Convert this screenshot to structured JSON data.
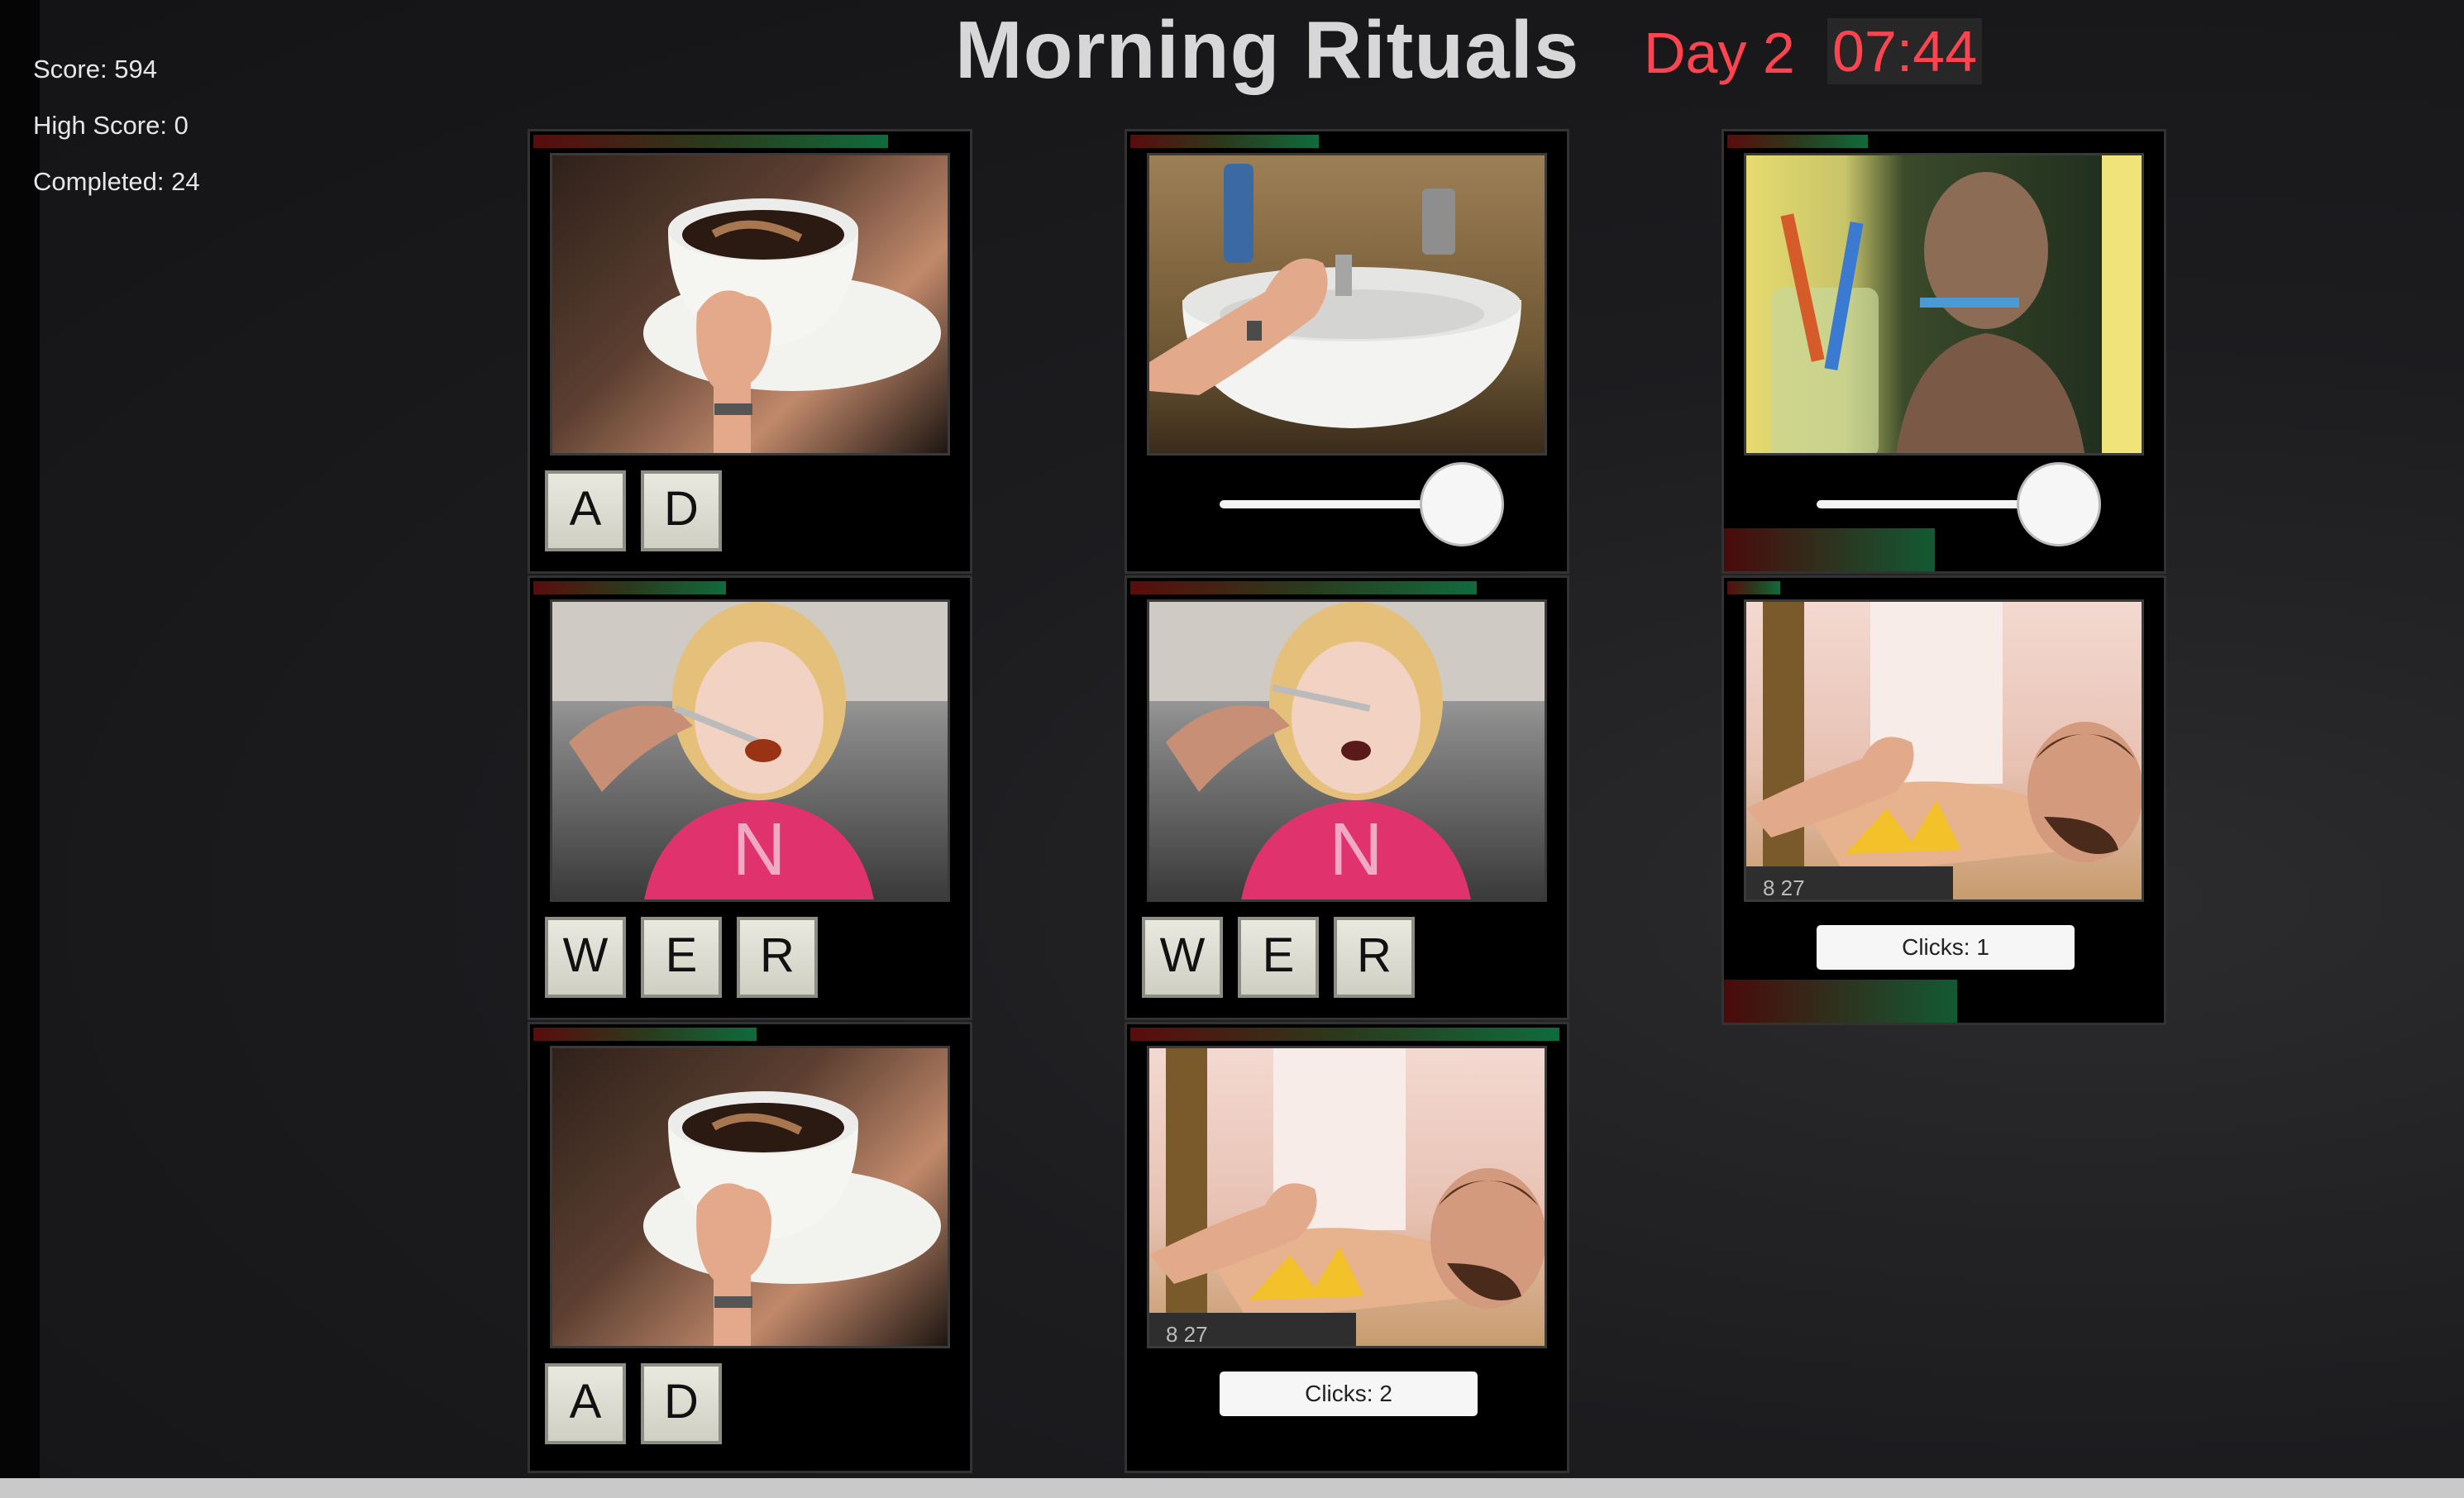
{
  "hud": {
    "score": "Score: 594",
    "high_score": "High Score: 0",
    "completed": "Completed: 24",
    "title": "Morning Rituals",
    "day": "Day 2",
    "clock": "07:44"
  },
  "panels": [
    {
      "id": "coffee-1",
      "scene": "coffee-cup-fist",
      "keys": [
        "A",
        "D"
      ],
      "timer_fraction": 0.81
    },
    {
      "id": "sink",
      "scene": "sink-hand-turning-tap",
      "slider_value": 1.0,
      "timer_fraction": 0.43
    },
    {
      "id": "toothbrush",
      "scene": "man-brushing-teeth-mirror",
      "slider_value": 1.0,
      "timer_fraction": 0.32,
      "meter_fraction": 0.48
    },
    {
      "id": "feed-1",
      "scene": "child-being-fed",
      "keys": [
        "W",
        "E",
        "R"
      ],
      "timer_fraction": 0.44
    },
    {
      "id": "feed-2",
      "scene": "child-being-fed",
      "keys": [
        "W",
        "E",
        "R"
      ],
      "timer_fraction": 0.79
    },
    {
      "id": "alarm-1",
      "scene": "man-sleeping-alarm-clock",
      "counter": "Clicks: 1",
      "timer_fraction": 0.12,
      "meter_fraction": 0.53
    },
    {
      "id": "coffee-2",
      "scene": "coffee-cup-fist",
      "keys": [
        "A",
        "D"
      ],
      "timer_fraction": 0.51
    },
    {
      "id": "alarm-2",
      "scene": "man-sleeping-alarm-clock",
      "counter": "Clicks: 2",
      "timer_fraction": 0.98
    }
  ],
  "colors": {
    "accent_red": "#ff4450",
    "timer_start": "#5a0c0c",
    "timer_end": "#0f6b3c"
  }
}
